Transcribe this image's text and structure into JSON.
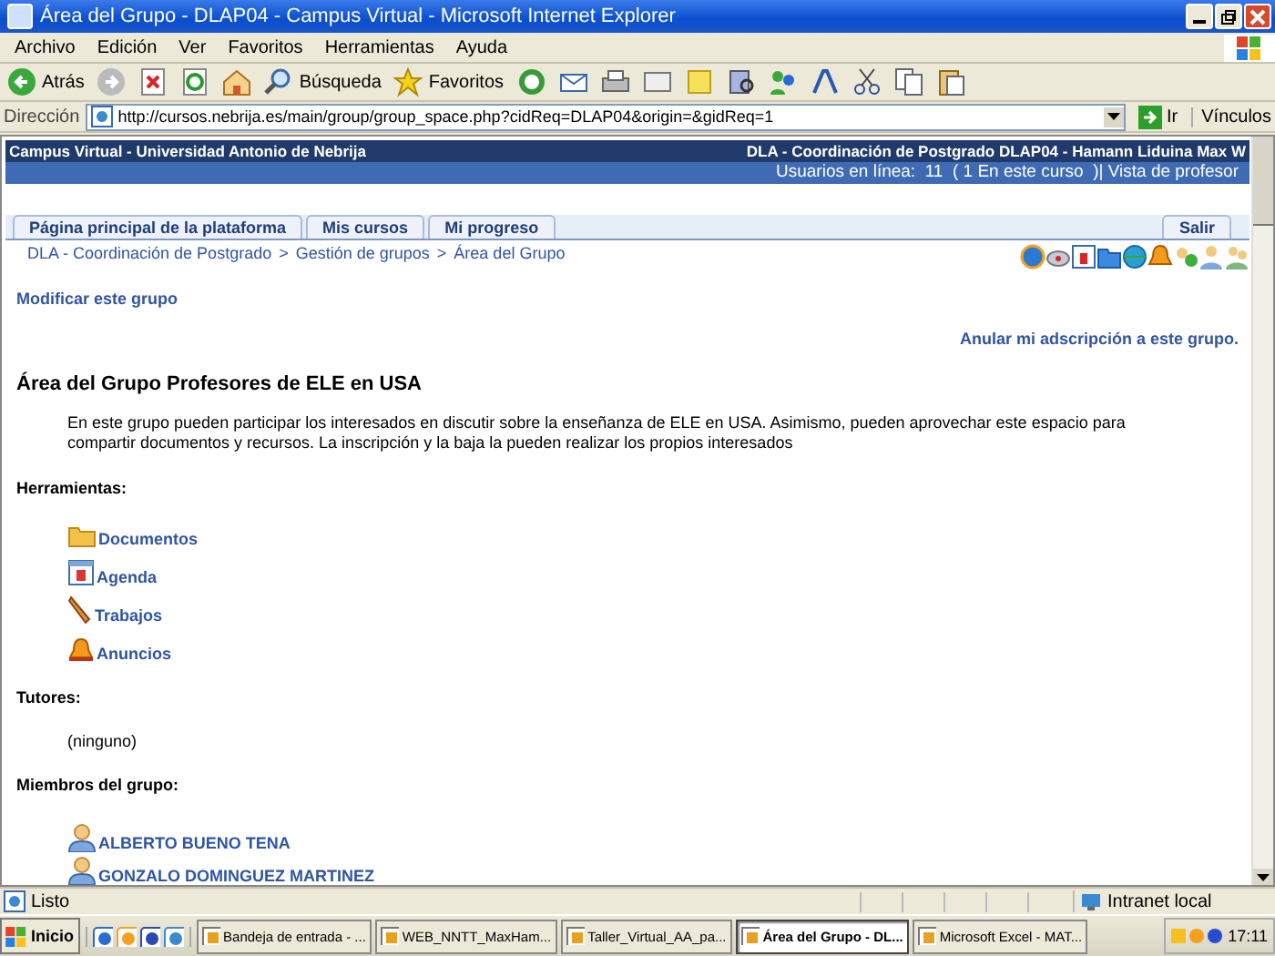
{
  "window": {
    "title": "Área del Grupo - DLAP04 - Campus Virtual - Microsoft Internet Explorer"
  },
  "menu": [
    "Archivo",
    "Edición",
    "Ver",
    "Favoritos",
    "Herramientas",
    "Ayuda"
  ],
  "toolbar": {
    "back_label": "Atrás",
    "search_label": "Búsqueda",
    "favorites_label": "Favoritos"
  },
  "address_bar": {
    "label": "Dirección",
    "url": "http://cursos.nebrija.es/main/group/group_space.php?cidReq=DLAP04&origin=&gidReq=1",
    "go_label": "Ir",
    "links_label": "Vínculos"
  },
  "page": {
    "header_left": "Campus Virtual - Universidad Antonio de Nebrija",
    "header_right": "DLA - Coordinación de Postgrado DLAP04 - Hamann Liduina Max W",
    "online_text": "Usuarios en línea:  11  ( 1 En este curso  )| Vista de profesor",
    "tabs": [
      "Página principal de la plataforma",
      "Mis cursos",
      "Mi progreso"
    ],
    "logout": "Salir",
    "breadcrumb": [
      "DLA - Coordinación de Postgrado",
      "Gestión de grupos",
      "Área del Grupo"
    ],
    "breadcrumb_separator": ">",
    "modify_link": "Modificar este grupo",
    "unsubscribe_link": "Anular mi adscripción a este grupo.",
    "heading": "Área del Grupo Profesores de ELE en USA",
    "description": "En este grupo pueden participar los interesados en discutir sobre la enseñanza de ELE en USA. Asimismo, pueden aprovechar este espacio para compartir documentos y recursos. La inscripción y la baja la pueden realizar los propios interesados",
    "tools_heading": "Herramientas:",
    "tools": [
      {
        "label": "Documentos",
        "kind": "folder"
      },
      {
        "label": "Agenda",
        "kind": "calendar"
      },
      {
        "label": "Trabajos",
        "kind": "pencil"
      },
      {
        "label": "Anuncios",
        "kind": "bell"
      }
    ],
    "tutors_heading": "Tutores:",
    "tutors_text": "(ninguno)",
    "members_heading": "Miembros del grupo:",
    "members": [
      "ALBERTO BUENO TENA",
      "GONZALO DOMINGUEZ MARTINEZ"
    ]
  },
  "status_bar": {
    "text": "Listo",
    "zone": "Intranet local"
  },
  "taskbar": {
    "start": "Inicio",
    "tasks": [
      {
        "label": "Bandeja de entrada - ...",
        "selected": false
      },
      {
        "label": "WEB_NNTT_MaxHam...",
        "selected": false
      },
      {
        "label": "Taller_Virtual_AA_pa...",
        "selected": false
      },
      {
        "label": "Área del Grupo - DL...",
        "selected": true
      },
      {
        "label": "Microsoft Excel - MAT...",
        "selected": false
      }
    ],
    "clock": "17:11"
  }
}
